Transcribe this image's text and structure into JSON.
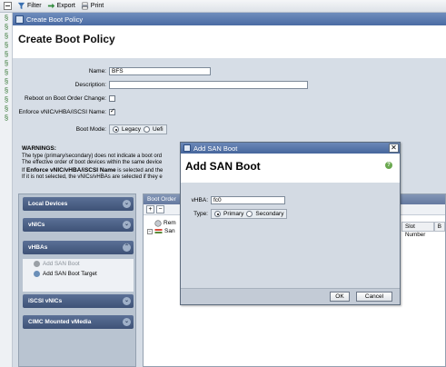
{
  "toolbar": {
    "filter": "Filter",
    "export": "Export",
    "print": "Print"
  },
  "window": {
    "title": "Create Boot Policy",
    "heading": "Create Boot Policy"
  },
  "form": {
    "name_label": "Name:",
    "name_value": "BFS",
    "description_label": "Description:",
    "description_value": "",
    "reboot_label": "Reboot on Boot Order Change:",
    "reboot_checked": false,
    "enforce_label": "Enforce vNIC/vHBA/iSCSI Name:",
    "enforce_checked": true,
    "boot_mode_label": "Boot Mode:",
    "boot_mode_options": [
      "Legacy",
      "Uefi"
    ],
    "boot_mode_selected": "Legacy"
  },
  "warnings": {
    "title": "WARNINGS:",
    "line1": "The type (primary/secondary) does not indicate a boot ord",
    "line2": "The effective order of boot devices within the same device",
    "line3_prefix": "If ",
    "line3_bold": "Enforce vNIC/vHBA/iSCSI Name",
    "line3_suffix": " is selected and the",
    "line4": "If it is not selected, the vNICs/vHBAs are selected if they e"
  },
  "devices": {
    "sections": [
      "Local Devices",
      "vNICs",
      "vHBAs",
      "iSCSI vNICs",
      "CIMC Mounted vMedia"
    ],
    "vhba_items": [
      "Add SAN Boot",
      "Add SAN Boot Target"
    ]
  },
  "boot_order": {
    "header": "Boot Order",
    "tree": [
      "Rem",
      "San"
    ],
    "columns": [
      "Slot Number",
      "B"
    ]
  },
  "dialog": {
    "title": "Add SAN Boot",
    "heading": "Add SAN Boot",
    "vhba_label": "vHBA:",
    "vhba_value": "fc0",
    "type_label": "Type:",
    "type_options": [
      "Primary",
      "Secondary"
    ],
    "type_selected": "Primary",
    "ok": "OK",
    "cancel": "Cancel"
  }
}
